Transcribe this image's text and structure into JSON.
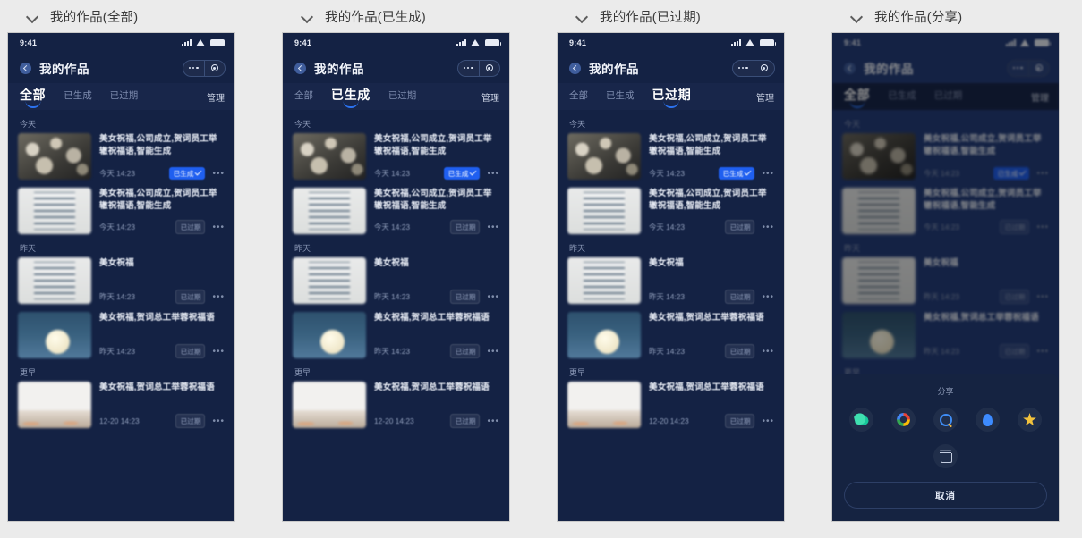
{
  "panels": [
    {
      "caption": "我的作品(全部)",
      "active_tab": 0,
      "dimmed": false,
      "overlay": false
    },
    {
      "caption": "我的作品(已生成)",
      "active_tab": 1,
      "dimmed": false,
      "overlay": false
    },
    {
      "caption": "我的作品(已过期)",
      "active_tab": 2,
      "dimmed": false,
      "overlay": false
    },
    {
      "caption": "我的作品(分享)",
      "active_tab": 0,
      "dimmed": true,
      "overlay": true
    }
  ],
  "status_bar": {
    "time": "9:41",
    "signal_icon": "signal-bars-icon",
    "wifi_icon": "wifi-icon",
    "battery_icon": "battery-icon"
  },
  "navbar": {
    "back_icon": "back-arrow-icon",
    "title": "我的作品",
    "capsule": {
      "more_icon": "ellipsis-icon",
      "target_icon": "target-circle-icon"
    }
  },
  "tabs": {
    "items": [
      "全部",
      "已生成",
      "已过期"
    ],
    "manage_label": "管理",
    "active_color": "#2b72f0"
  },
  "list": {
    "groups": [
      {
        "title": "今天",
        "rows": [
          {
            "thumb": "tw-confetti",
            "title": "美女祝福,公司成立,贺词员工举辙祝福语,智能生成",
            "time": "今天 14:23",
            "badge": "已生成",
            "badge_state": "done",
            "more_icon": "more-dots-icon"
          },
          {
            "thumb": "tw-card",
            "title": "美女祝福,公司成立,贺词员工举辙祝福语,智能生成",
            "time": "今天 14:23",
            "badge": "已过期",
            "badge_state": "expired",
            "more_icon": "more-dots-icon"
          }
        ]
      },
      {
        "title": "昨天",
        "rows": [
          {
            "thumb": "tw-card",
            "title": "美女祝福",
            "time": "昨天 14:23",
            "badge": "已过期",
            "badge_state": "expired",
            "more_icon": "more-dots-icon"
          },
          {
            "thumb": "tw-moon",
            "title": "美女祝福,贺词总工举蓉祝福语",
            "time": "昨天 14:23",
            "badge": "已过期",
            "badge_state": "expired",
            "more_icon": "more-dots-icon"
          }
        ]
      },
      {
        "title": "更早",
        "rows": [
          {
            "thumb": "tw-room",
            "title": "美女祝福,贺词总工举蓉祝福语",
            "time": "12-20 14:23",
            "badge": "已过期",
            "badge_state": "expired",
            "more_icon": "more-dots-icon"
          }
        ]
      }
    ]
  },
  "share_sheet": {
    "label": "分享",
    "icons": [
      {
        "name": "wechat-icon",
        "glyph": "g-wechat"
      },
      {
        "name": "google-photos-icon",
        "glyph": "g-photos"
      },
      {
        "name": "search-icon",
        "glyph": "g-search"
      },
      {
        "name": "water-drop-icon",
        "glyph": "g-drop"
      },
      {
        "name": "star-icon",
        "glyph": "g-star"
      }
    ],
    "delete_icon": "trash-icon",
    "cancel_label": "取消"
  },
  "colors": {
    "page_background": "#ebebeb",
    "phone_background": "#142244",
    "tabbar_background": "#18264a",
    "accent": "#2b72f0",
    "badge_done": "#1f5ff0",
    "overlay_background": "#152341"
  }
}
